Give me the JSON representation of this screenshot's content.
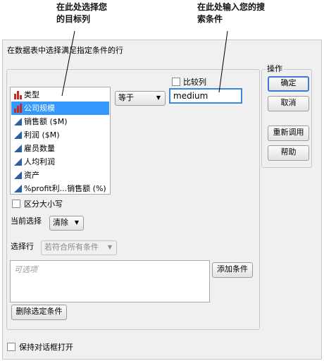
{
  "annotations": {
    "left_line1": "在此处选择您",
    "left_line2": "的目标列",
    "right_line1": "在此处输入您的搜",
    "right_line2": "索条件"
  },
  "dialog": {
    "title": "在数据表中选择满足指定条件的行",
    "column_list": [
      {
        "label": "类型",
        "icon": "nominal-bar-icon",
        "selected": false
      },
      {
        "label": "公司规模",
        "icon": "ordinal-bar-icon",
        "selected": true
      },
      {
        "label": "销售额 ($M)",
        "icon": "continuous-triangle-icon",
        "selected": false
      },
      {
        "label": "利润 ($M)",
        "icon": "continuous-triangle-icon",
        "selected": false
      },
      {
        "label": "雇员数量",
        "icon": "continuous-triangle-icon",
        "selected": false
      },
      {
        "label": "人均利润",
        "icon": "continuous-triangle-icon",
        "selected": false
      },
      {
        "label": "资产",
        "icon": "continuous-triangle-icon",
        "selected": false
      },
      {
        "label": "%profit利...销售额 (%)",
        "icon": "continuous-triangle-icon",
        "selected": false
      }
    ],
    "operator": {
      "value": "等于",
      "arrow": "▼"
    },
    "compare_column_label": "比较列",
    "search_value": "medium",
    "case_sensitive_label": "区分大小写",
    "current_selection_label": "当前选择",
    "current_selection_value": "清除",
    "select_rows_label": "选择行",
    "select_rows_value": "若符合所有条件",
    "conditions_placeholder": "可选项",
    "add_condition_button": "添加条件",
    "delete_condition_button": "删除选定条件",
    "actions_title": "操作",
    "ok_button": "确定",
    "cancel_button": "取消",
    "recall_button": "重新调用",
    "help_button": "帮助",
    "keep_open_label": "保持对话框打开"
  },
  "colors": {
    "selection": "#3399ff",
    "accent_border": "#3b7bd6",
    "nominal_red": "#c8281e",
    "continuous_blue": "#2a5fa8"
  }
}
